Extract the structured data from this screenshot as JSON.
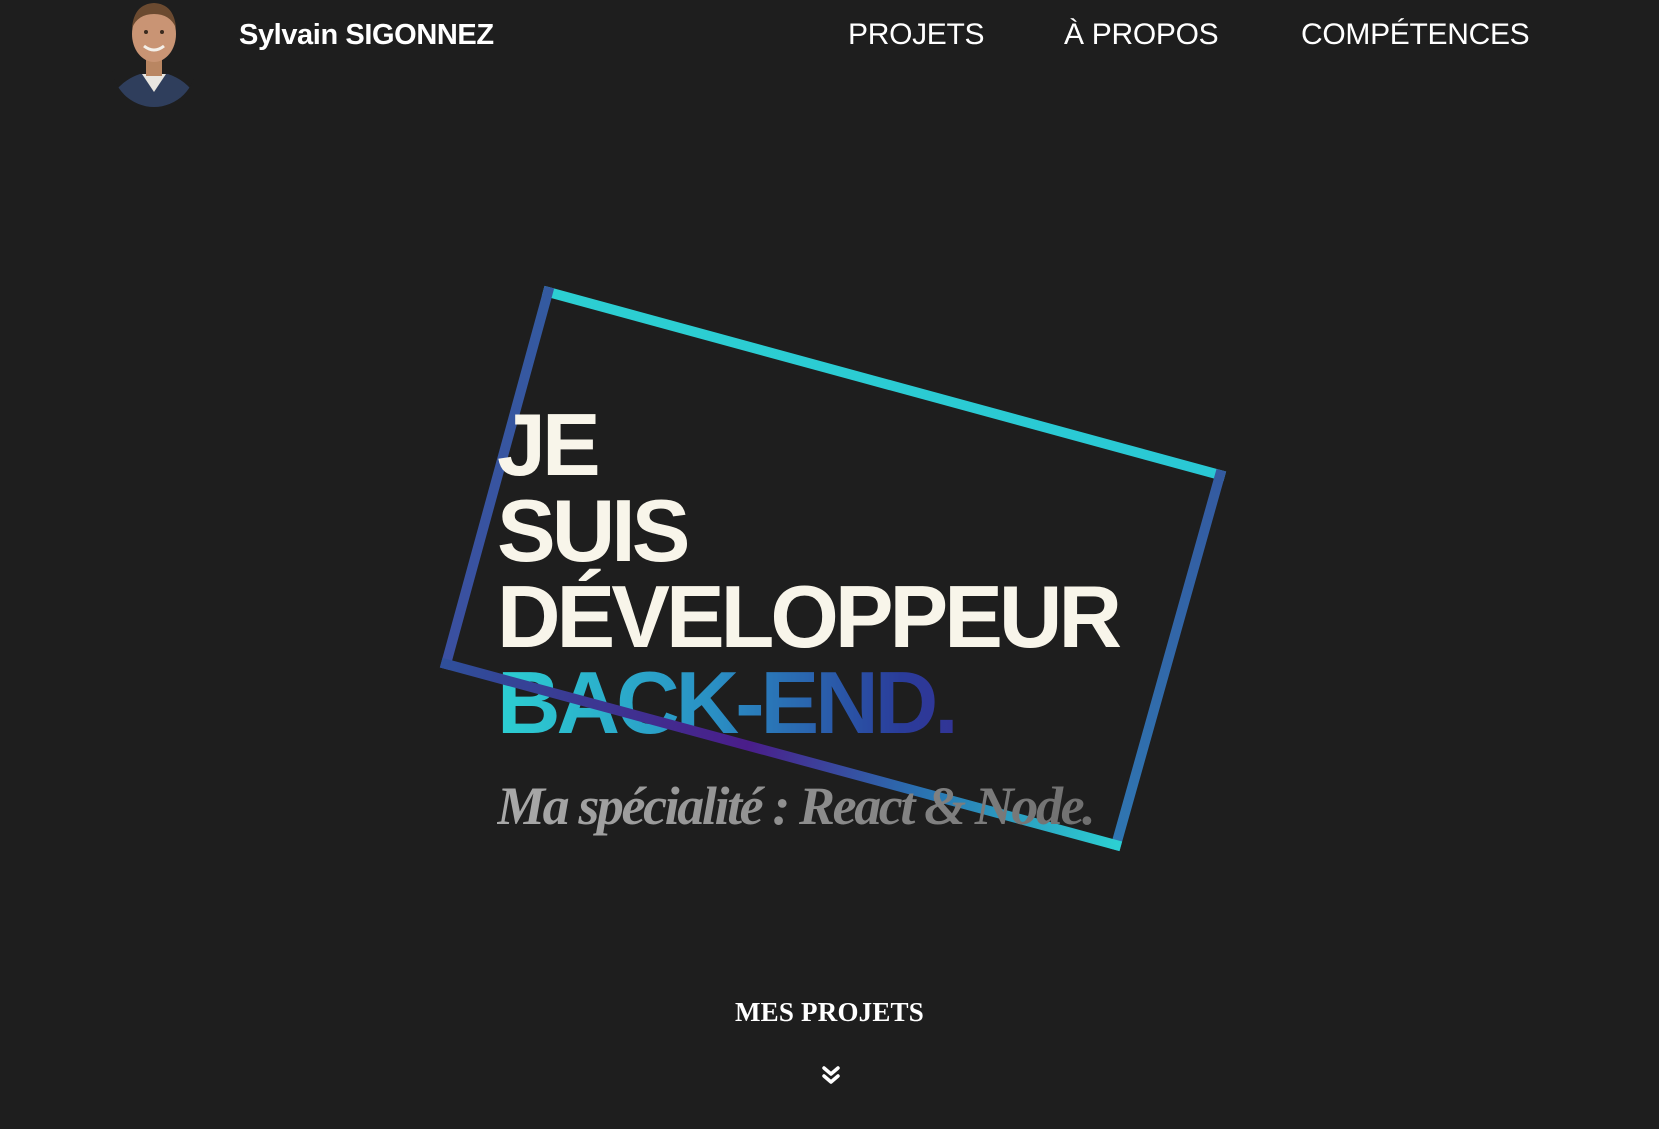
{
  "header": {
    "brand_name": "Sylvain SIGONNEZ",
    "nav": {
      "projets": "PROJETS",
      "a_propos": "À PROPOS",
      "competences": "COMPÉTENCES"
    }
  },
  "hero": {
    "line1": "JE",
    "line2": "SUIS",
    "line3": "DÉVELOPPEUR",
    "line4": "BACK-END.",
    "specialty": "Ma spécialité : React & Node."
  },
  "projects_link": {
    "label": "MES PROJETS",
    "icon": "double-chevron-down-icon"
  },
  "colors": {
    "background": "#1e1e1e",
    "text": "#f8f5ea",
    "cyan": "#2ccfd2",
    "blue": "#345aa0",
    "violet": "#4a1d8a"
  }
}
